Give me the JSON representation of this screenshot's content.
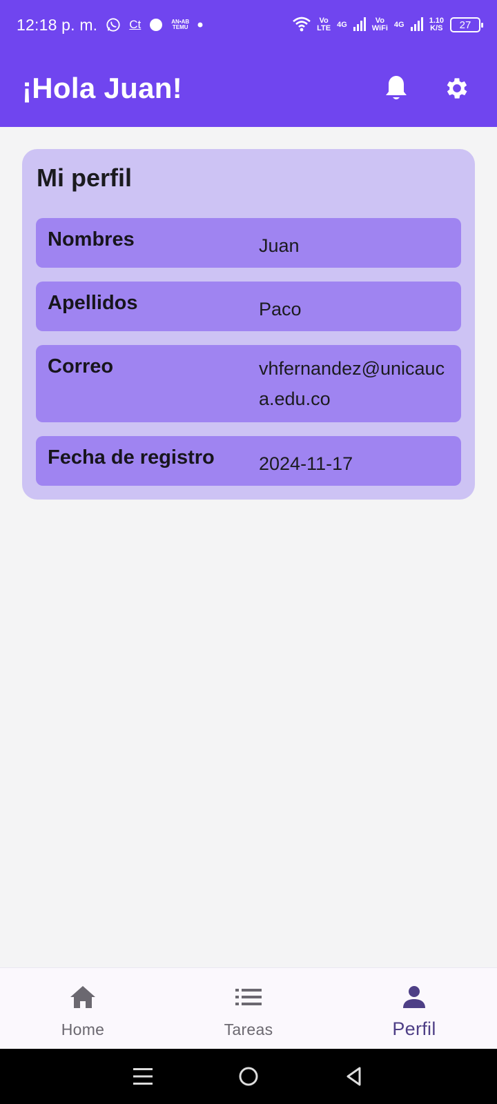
{
  "status_bar": {
    "time": "12:18 p. m.",
    "ct_label": "Ct",
    "temu_top": "AN•AB",
    "temu_bottom": "TEMU",
    "volte_top": "Vo",
    "volte_bottom": "LTE",
    "net1": "4G",
    "vowifi_top": "Vo",
    "vowifi_bottom": "WiFi",
    "net2": "4G",
    "speed_top": "1.10",
    "speed_bottom": "K/S",
    "battery": "27",
    "icons": [
      "whatsapp-icon",
      "dot-icon",
      "wifi-icon",
      "signal-icon",
      "battery-icon"
    ]
  },
  "app_bar": {
    "title": "¡Hola Juan!",
    "icons": [
      "bell-icon",
      "gear-icon"
    ]
  },
  "profile": {
    "title": "Mi perfil",
    "fields": [
      {
        "label": "Nombres",
        "value": "Juan"
      },
      {
        "label": "Apellidos",
        "value": "Paco"
      },
      {
        "label": "Correo",
        "value": "vhfernandez@unicauca.edu.co"
      },
      {
        "label": "Fecha de registro",
        "value": "2024-11-17"
      }
    ]
  },
  "bottom_nav": {
    "items": [
      {
        "label": "Home",
        "icon": "home-icon",
        "active": false
      },
      {
        "label": "Tareas",
        "icon": "list-icon",
        "active": false
      },
      {
        "label": "Perfil",
        "icon": "person-icon",
        "active": true
      }
    ]
  },
  "colors": {
    "primary": "#7045ef",
    "card_bg": "#cdc3f4",
    "row_bg": "#9f84f1",
    "page_bg": "#f4f4f5",
    "nav_active": "#4e3f86",
    "nav_inactive": "#6b6870"
  }
}
